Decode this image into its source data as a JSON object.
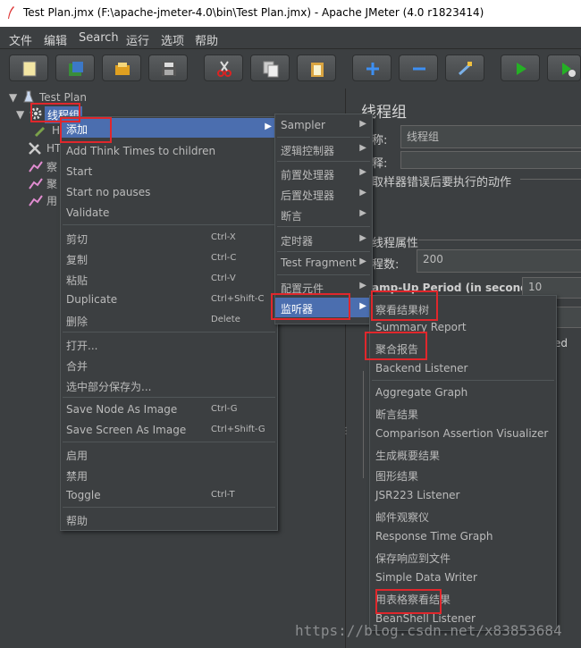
{
  "window": {
    "title": "Test Plan.jmx (F:\\apache-jmeter-4.0\\bin\\Test Plan.jmx) - Apache JMeter (4.0 r1823414)"
  },
  "menubar": [
    "文件",
    "编辑",
    "Search",
    "运行",
    "选项",
    "帮助"
  ],
  "toolbar": [
    "new-icon",
    "templates-icon",
    "open-icon",
    "save-icon",
    "cut-icon",
    "copy-icon",
    "paste-icon",
    "expand-icon",
    "collapse-icon",
    "toggle-icon",
    "start-icon",
    "start-no-pause-icon"
  ],
  "tree": {
    "root": "Test Plan",
    "selected": "线程组",
    "children": [
      "H",
      "HT",
      "察",
      "聚",
      "用"
    ]
  },
  "right": {
    "title": "线程组",
    "name_label": "称:",
    "name_value": "线程组",
    "comment_label": "释:",
    "error_label": "取样器错误后要执行的动作",
    "props_label": "线程属性",
    "threads_label": "程数:",
    "threads_value": "200",
    "rampup_label": "amp-Up Period (in seconds):",
    "rampup_value": "10",
    "ed": "ed"
  },
  "context_menu": {
    "items": [
      {
        "label": "添加",
        "submenu": true
      },
      {
        "label": "Add Think Times to children"
      },
      {
        "label": "Start"
      },
      {
        "label": "Start no pauses"
      },
      {
        "label": "Validate"
      },
      {
        "label": "剪切",
        "shortcut": "Ctrl-X"
      },
      {
        "label": "复制",
        "shortcut": "Ctrl-C"
      },
      {
        "label": "粘贴",
        "shortcut": "Ctrl-V"
      },
      {
        "label": "Duplicate",
        "shortcut": "Ctrl+Shift-C"
      },
      {
        "label": "删除",
        "shortcut": "Delete"
      },
      {
        "label": "打开..."
      },
      {
        "label": "合并"
      },
      {
        "label": "选中部分保存为..."
      },
      {
        "label": "Save Node As Image",
        "shortcut": "Ctrl-G"
      },
      {
        "label": "Save Screen As Image",
        "shortcut": "Ctrl+Shift-G"
      },
      {
        "label": "启用"
      },
      {
        "label": "禁用"
      },
      {
        "label": "Toggle",
        "shortcut": "Ctrl-T"
      },
      {
        "label": "帮助"
      }
    ]
  },
  "add_submenu": {
    "items": [
      "Sampler",
      "逻辑控制器",
      "前置处理器",
      "后置处理器",
      "断言",
      "定时器",
      "Test Fragment",
      "配置元件",
      "监听器"
    ]
  },
  "listener_submenu": {
    "items": [
      "察看结果树",
      "Summary Report",
      "聚合报告",
      "Backend Listener",
      "Aggregate Graph",
      "断言结果",
      "Comparison Assertion Visualizer",
      "生成概要结果",
      "图形结果",
      "JSR223 Listener",
      "邮件观察仪",
      "Response Time Graph",
      "保存响应到文件",
      "Simple Data Writer",
      "用表格察看结果",
      "BeanShell Listener"
    ]
  },
  "watermark": "https://blog.csdn.net/x83853684"
}
